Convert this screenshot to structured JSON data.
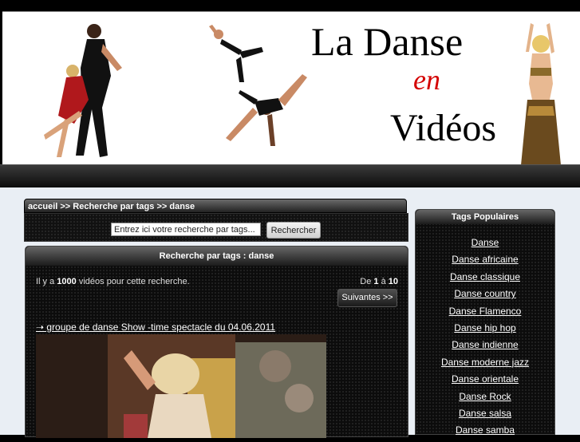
{
  "header": {
    "logo_line1": "La Danse",
    "logo_line2": "en",
    "logo_line3": "Vidéos"
  },
  "breadcrumb": {
    "home": "accueil",
    "sep1": " >> ",
    "section": "Recherche par tags",
    "sep2": " >> ",
    "current": "danse"
  },
  "search": {
    "placeholder": "Entrez ici votre recherche par tags...",
    "button_label": "Rechercher"
  },
  "results": {
    "title": "Recherche par tags : danse",
    "count_prefix": "Il y a ",
    "count": "1000",
    "count_suffix": " vidéos pour cette recherche.",
    "range_prefix": "De ",
    "range_start": "1",
    "range_mid": " à ",
    "range_end": "10",
    "next_label": "Suivantes >>",
    "videos": [
      {
        "title": "➝ groupe de danse Show -time spectacle du 04.06.2011"
      }
    ]
  },
  "sidebar": {
    "title": "Tags Populaires",
    "tags": [
      "Danse",
      "Danse africaine",
      "Danse classique",
      "Danse country",
      "Danse Flamenco",
      "Danse hip hop",
      "Danse indienne",
      "Danse moderne jazz",
      "Danse orientale",
      "Danse Rock",
      "Danse salsa",
      "Danse samba"
    ]
  }
}
